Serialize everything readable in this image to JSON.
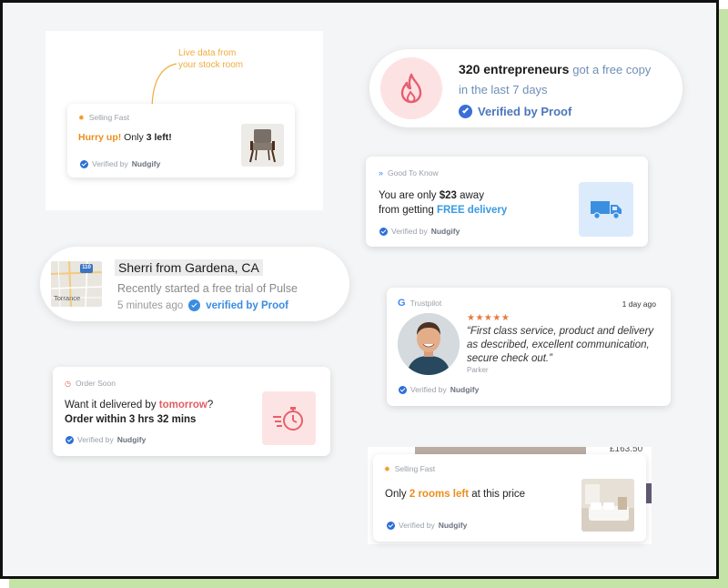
{
  "stock_room_panel": {
    "annotation_line1": "Live data from",
    "annotation_line2": "your stock room",
    "card": {
      "header": "Selling Fast",
      "hurry": "Hurry up!",
      "only": "Only",
      "count": "3 left!",
      "verified_prefix": "Verified by",
      "verified_brand": "Nudgify"
    }
  },
  "entrepreneurs_card": {
    "count_bold": "320 entrepreneurs",
    "rest": "got a free copy",
    "line2": "in the last 7 days",
    "verified": "Verified by Proof"
  },
  "free_delivery_card": {
    "header": "Good To Know",
    "line1_prefix": "You are only",
    "amount": "$23",
    "line1_suffix": "away",
    "line2_prefix": "from getting",
    "free_delivery": "FREE delivery",
    "verified_prefix": "Verified by",
    "verified_brand": "Nudgify"
  },
  "trial_card": {
    "name": "Sherri from Gardena, CA",
    "action": "Recently started a free trial of Pulse",
    "time": "5 minutes ago",
    "verified": "verified by Proof",
    "map_label": "Torrance",
    "map_shield": "110"
  },
  "trustpilot_card": {
    "brand": "Trustpilot",
    "time": "1 day ago",
    "stars": "★★★★★",
    "quote": "“First class service, product and delivery as described, excellent communication, secure check out.”",
    "author": "Parker",
    "verified_prefix": "Verified by",
    "verified_brand": "Nudgify"
  },
  "order_soon_card": {
    "header": "Order Soon",
    "line1_prefix": "Want it delivered by",
    "tomorrow": "tomorrow",
    "line1_suffix": "?",
    "line2": "Order within 3 hrs 32 mins",
    "verified_prefix": "Verified by",
    "verified_brand": "Nudgify"
  },
  "rooms_card": {
    "header": "Selling Fast",
    "only": "Only",
    "rooms": "2 rooms left",
    "suffix": "at this price",
    "bg_price": "£163.50",
    "verified_prefix": "Verified by",
    "verified_brand": "Nudgify"
  },
  "colors": {
    "accent_orange": "#ea8f1d",
    "accent_blue": "#3a9ae2",
    "accent_red": "#e25f60",
    "proof_blue": "#2b6fd8",
    "frame_shadow": "#c4e3a6"
  }
}
